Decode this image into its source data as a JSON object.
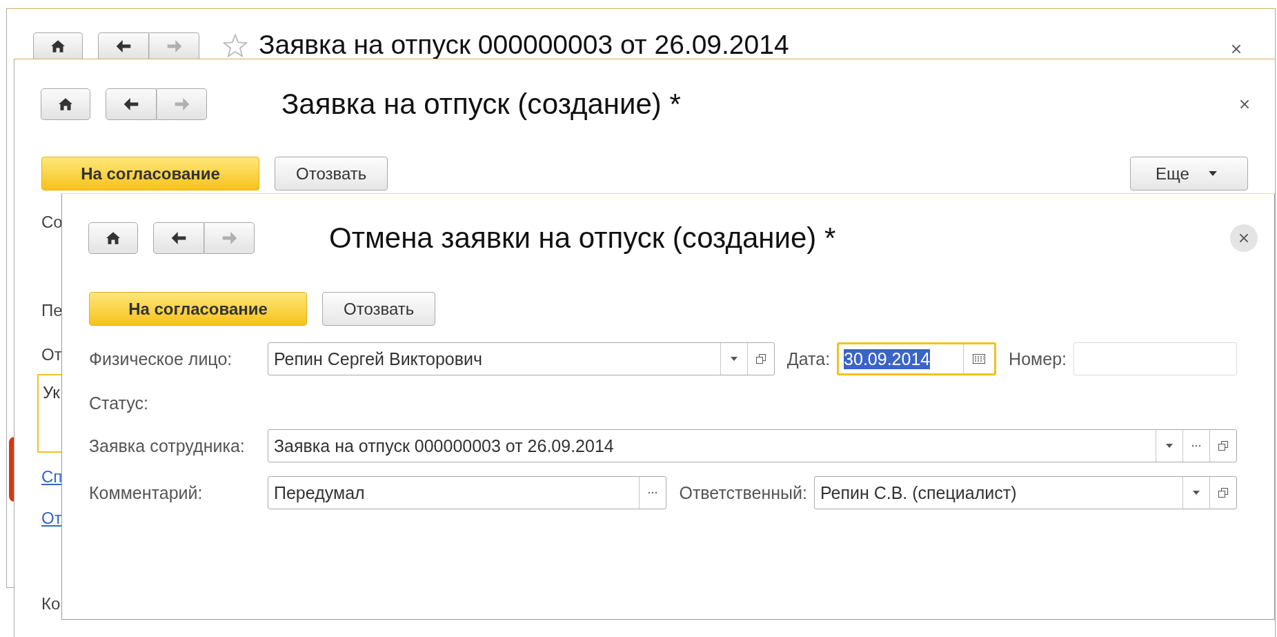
{
  "windows": [
    {
      "kind": "document",
      "active": false,
      "title": "Заявка на отпуск 000000003 от 26.09.2014",
      "favorite": false,
      "nav": {
        "back_enabled": true,
        "forward_enabled": false
      }
    },
    {
      "kind": "form",
      "active": false,
      "title": "Заявка на отпуск (создание) *",
      "nav": {
        "back_enabled": true,
        "forward_enabled": false
      },
      "buttons": [
        {
          "label": "На согласование",
          "kind": "primary"
        },
        {
          "label": "Отозвать",
          "kind": "normal"
        }
      ],
      "more_button": {
        "label": "Еще"
      },
      "side_items": [
        {
          "kind": "label",
          "text": "Со"
        },
        {
          "kind": "label",
          "text": "Пе"
        },
        {
          "kind": "label",
          "text": "От"
        },
        {
          "kind": "memo",
          "text": "Ук",
          "focused": true
        },
        {
          "kind": "link",
          "text": "Сп"
        },
        {
          "kind": "link",
          "text": "От"
        },
        {
          "kind": "label",
          "text": "Ко"
        }
      ]
    },
    {
      "kind": "dialog",
      "active": true,
      "title": "Отмена заявки на отпуск (создание) *",
      "nav": {
        "back_enabled": true,
        "forward_enabled": false
      },
      "buttons": [
        {
          "label": "На согласование",
          "kind": "primary"
        },
        {
          "label": "Отозвать",
          "kind": "normal"
        }
      ],
      "fields": [
        {
          "label": "Физическое лицо:",
          "kind": "combo",
          "value": "Репин Сергей Викторович",
          "dropdown": true,
          "open": true
        },
        {
          "label": "Дата:",
          "kind": "date",
          "inline": true,
          "value": "30.09.2014",
          "focused": true,
          "text_selected": true,
          "calendar": true
        },
        {
          "label": "Номер:",
          "kind": "number",
          "inline": true,
          "disabled": true
        },
        {
          "label": "Статус:",
          "kind": "label"
        },
        {
          "label": "Заявка сотрудника:",
          "kind": "combo",
          "value": "Заявка на отпуск 000000003 от 26.09.2014",
          "dropdown": true,
          "choose": true,
          "open": true
        },
        {
          "label": "Комментарий:",
          "kind": "text",
          "value": "Передумал",
          "choose": true
        },
        {
          "label": "Ответственный:",
          "kind": "combo",
          "inline": true,
          "value": "Репин С.В. (специалист)",
          "dropdown": true,
          "open": true
        }
      ]
    }
  ]
}
